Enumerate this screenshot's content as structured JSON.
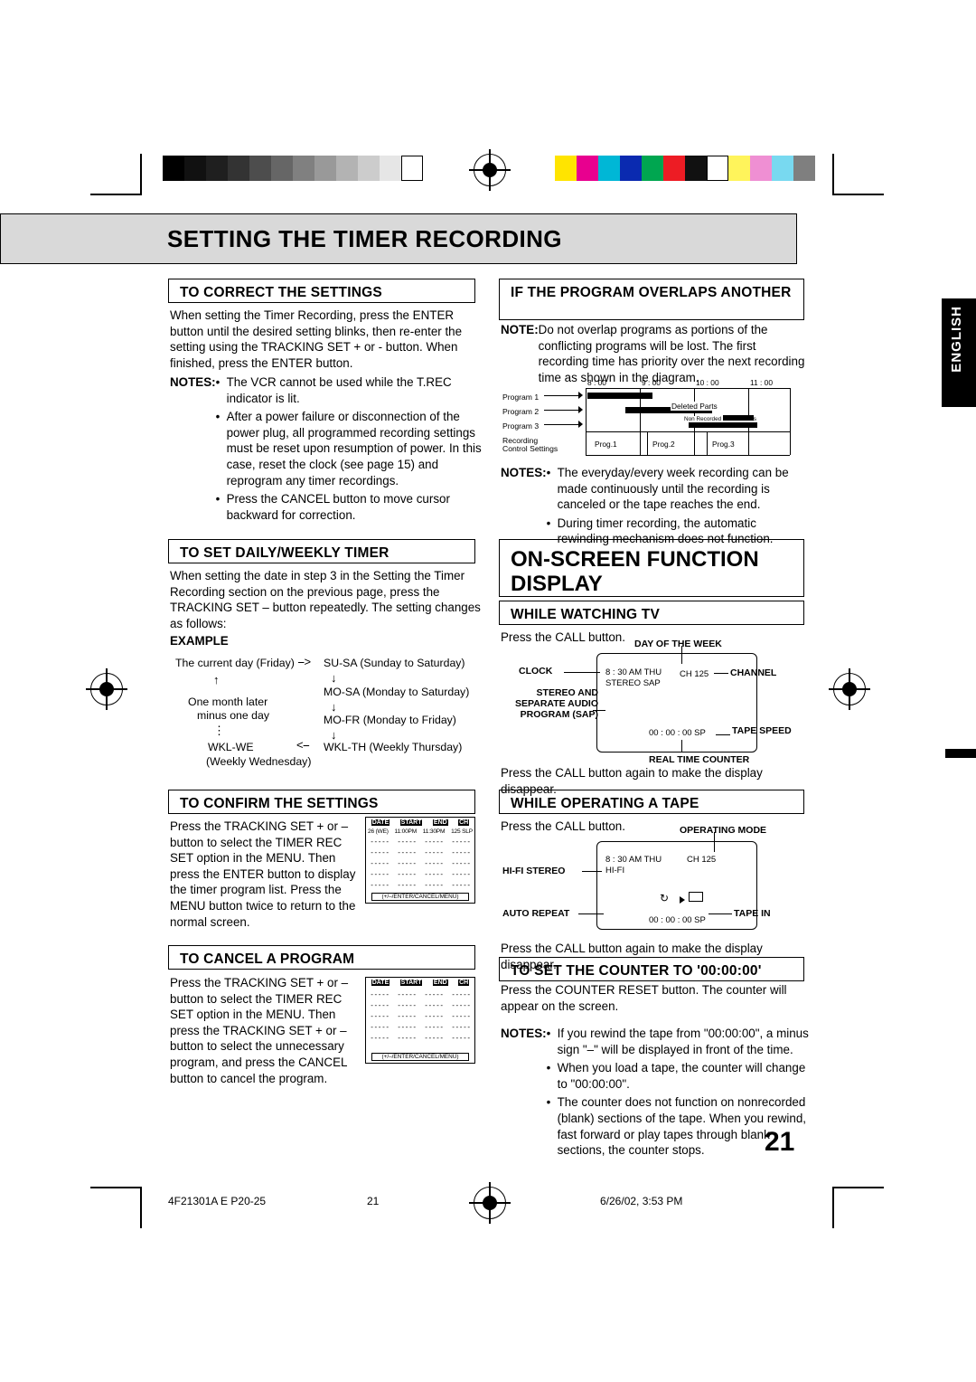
{
  "page": {
    "title": "SETTING THE TIMER RECORDING",
    "language_tab": "ENGLISH",
    "page_number": "21"
  },
  "footer": {
    "left": "4F21301A E P20-25",
    "center": "21",
    "right": "6/26/02, 3:53 PM"
  },
  "left_column": {
    "correct": {
      "heading": "TO CORRECT THE SETTINGS",
      "body": "When setting the Timer Recording, press the ENTER button until the desired setting blinks, then re-enter the setting using the TRACKING SET + or - button. When finished, press the ENTER button.",
      "notes_label": "NOTES:",
      "notes": [
        "The VCR cannot be used while the T.REC indicator is lit.",
        "After a power failure or disconnection of the power plug, all programmed recording settings must be reset upon resumption of power. In this case, reset the clock (see page 15) and reprogram any timer recordings.",
        "Press the CANCEL button to move cursor backward for correction."
      ]
    },
    "daily_weekly": {
      "heading": "TO SET DAILY/WEEKLY TIMER",
      "body": "When setting the date in step 3 in the Setting the Timer Recording section on the previous page, press the TRACKING SET – button repeatedly. The setting changes as follows:",
      "example_label": "EXAMPLE",
      "flow": {
        "n1": "The current day (Friday)",
        "n2": "SU-SA (Sunday to Saturday)",
        "n3": "MO-SA (Monday to Saturday)",
        "n4": "MO-FR (Monday to Friday)",
        "n5": "WKL-TH (Weekly Thursday)",
        "n6": "WKL-WE",
        "n6b": "(Weekly Wednesday)",
        "n7a": "One month later",
        "n7b": "minus one day"
      }
    },
    "confirm": {
      "heading": "TO CONFIRM THE SETTINGS",
      "body": "Press the TRACKING SET + or – button to select the TIMER REC SET option in the MENU. Then press the ENTER button to display the timer program list. Press the MENU button twice to return to the normal screen.",
      "menu": {
        "headers": [
          "DATE",
          "START",
          "END",
          "CH"
        ],
        "row1": [
          "26 (WE)",
          "11:00PM",
          "11:30PM",
          "125 SLP"
        ],
        "dashes": "- - - - -",
        "footer": "(+/–/ENTER/CANCEL/MENU)"
      }
    },
    "cancel": {
      "heading": "TO CANCEL A PROGRAM",
      "body": "Press the TRACKING SET + or – button to select the TIMER REC SET option in the MENU. Then press the TRACKING SET + or – button to select the unnecessary program, and press the CANCEL button to cancel the program.",
      "menu": {
        "headers": [
          "DATE",
          "START",
          "END",
          "CH"
        ],
        "dashes": "- - - - -",
        "footer": "(+/–/ENTER/CANCEL/MENU)"
      }
    }
  },
  "right_column": {
    "overlap": {
      "heading": "IF THE PROGRAM OVERLAPS ANOTHER",
      "note_label": "NOTE:",
      "note": "Do not overlap programs as portions of the conflicting programs will be lost. The first recording time has priority over the next recording time as shown in the diagram.",
      "diagram": {
        "ticks": [
          "8 : 00",
          "9 : 00",
          "10 : 00",
          "11 : 00"
        ],
        "rows": [
          "Program 1",
          "Program 2",
          "Program 3"
        ],
        "rec_label_1": "Recording",
        "rec_label_2": "Control Settings",
        "deleted": "Deleted Parts",
        "nonrecorded": "Non Recorded Portion Parts",
        "progs": [
          "Prog.1",
          "Prog.2",
          "Prog.3"
        ]
      },
      "notes_label": "NOTES:",
      "notes": [
        "The everyday/every week recording can be made continuously until the recording is canceled or the tape reaches the end.",
        "During timer recording, the automatic rewinding mechanism does not function."
      ]
    },
    "osd_title": "ON-SCREEN FUNCTION DISPLAY",
    "watching_tv": {
      "heading": "WHILE WATCHING TV",
      "body": "Press the CALL button.",
      "callouts": {
        "day_of_week": "DAY OF THE WEEK",
        "clock": "CLOCK",
        "channel": "CHANNEL",
        "sap": "STEREO AND SEPARATE AUDIO PROGRAM (SAP)",
        "tape_speed": "TAPE SPEED",
        "counter": "REAL TIME COUNTER"
      },
      "screen": {
        "time": "8 : 30 AM  THU",
        "ch": "CH 125",
        "audio": "STEREO  SAP",
        "counter": "00 : 00 : 00  SP"
      },
      "after": "Press the CALL button again to make the display disappear."
    },
    "operating_tape": {
      "heading": "WHILE OPERATING A TAPE",
      "body": "Press the CALL button.",
      "callouts": {
        "operating_mode": "OPERATING MODE",
        "hifi": "HI-FI STEREO",
        "auto_repeat": "AUTO REPEAT",
        "tape_in": "TAPE IN"
      },
      "screen": {
        "time": "8 : 30 AM  THU",
        "ch": "CH 125",
        "hifi": "HI-FI",
        "counter": "00 : 00 : 00  SP"
      },
      "after": "Press the CALL button again to make the display disappear."
    },
    "counter": {
      "heading": "TO SET THE COUNTER TO '00:00:00'",
      "body": "Press the COUNTER RESET button. The counter will appear on the screen.",
      "notes_label": "NOTES:",
      "notes": [
        "If you rewind the tape from \"00:00:00\", a minus sign \"–\" will be displayed in front of the time.",
        "When you load a tape, the counter will change to \"00:00:00\".",
        "The counter does not function on nonrecorded (blank) sections of the tape. When you rewind, fast forward or play tapes through blank sections, the counter stops."
      ]
    }
  },
  "colors": {
    "title_bg": "#d9d9d9",
    "ink": "#000000"
  }
}
